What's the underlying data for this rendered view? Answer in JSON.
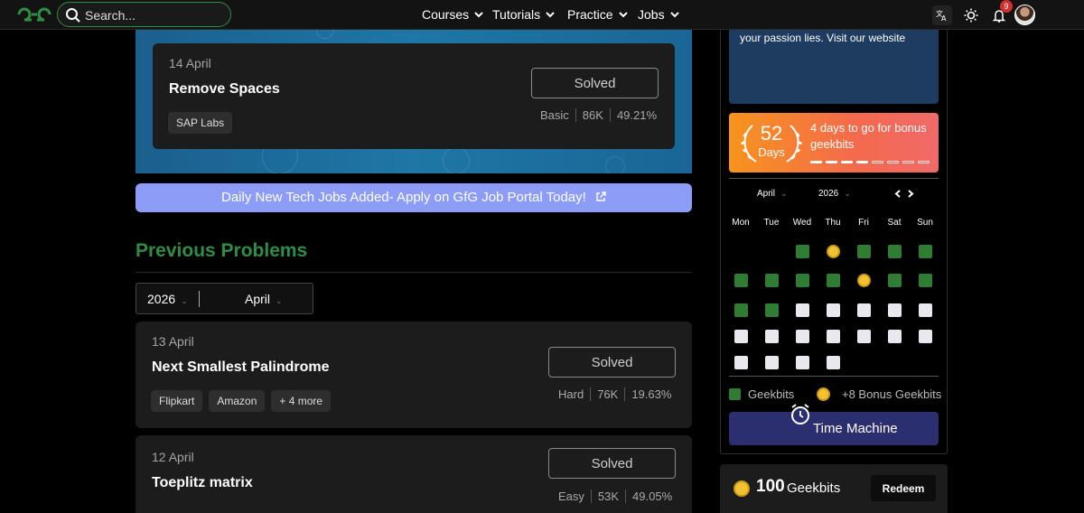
{
  "nav": {
    "search_placeholder": "Search...",
    "menu": [
      "Courses",
      "Tutorials",
      "Practice",
      "Jobs"
    ],
    "notification_count": "9"
  },
  "potd": {
    "date": "14 April",
    "title": "Remove Spaces",
    "tags": [
      "SAP Labs"
    ],
    "status": "Solved",
    "difficulty": "Basic",
    "submissions": "86K",
    "accuracy": "49.21%"
  },
  "banner": {
    "text": "Daily New Tech Jobs Added- Apply on GfG Job Portal Today!"
  },
  "previous": {
    "heading": "Previous Problems",
    "year": "2026",
    "month": "April",
    "problems": [
      {
        "date": "13 April",
        "title": "Next Smallest Palindrome",
        "tags": [
          "Flipkart",
          "Amazon",
          "+ 4 more"
        ],
        "status": "Solved",
        "difficulty": "Hard",
        "submissions": "76K",
        "accuracy": "19.63%"
      },
      {
        "date": "12 April",
        "title": "Toeplitz matrix",
        "tags": [],
        "status": "Solved",
        "difficulty": "Easy",
        "submissions": "53K",
        "accuracy": "49.05%"
      }
    ]
  },
  "sidebar": {
    "info_text": "your passion lies. Visit our website",
    "streak": {
      "count": "52",
      "unit": "Days",
      "message": "4 days to go for bonus geekbits",
      "progress_filled": 4,
      "progress_total": 8
    },
    "calendar": {
      "month": "April",
      "year": "2026",
      "weekdays": [
        "Mon",
        "Tue",
        "Wed",
        "Thu",
        "Fri",
        "Sat",
        "Sun"
      ],
      "weeks": [
        [
          "",
          "",
          "g",
          "coin",
          "g",
          "g",
          "g"
        ],
        [
          "g",
          "g",
          "g",
          "g",
          "coin",
          "g",
          "g"
        ],
        [
          "g",
          "g",
          "w",
          "w",
          "w",
          "w",
          "w"
        ],
        [
          "w",
          "w",
          "w",
          "w",
          "w",
          "w",
          "w"
        ],
        [
          "w",
          "w",
          "w",
          "w",
          "",
          "",
          ""
        ]
      ],
      "legend_geekbits": "Geekbits",
      "legend_bonus": "+8 Bonus Geekbits"
    },
    "time_machine": "Time Machine",
    "geekbits": {
      "count": "100",
      "label": "Geekbits",
      "redeem": "Redeem"
    }
  },
  "colors": {
    "brand_green": "#2f8d46",
    "streak_orange": "#f7941d",
    "time_machine": "#2b2f6f",
    "banner": "#8c9cf7"
  }
}
